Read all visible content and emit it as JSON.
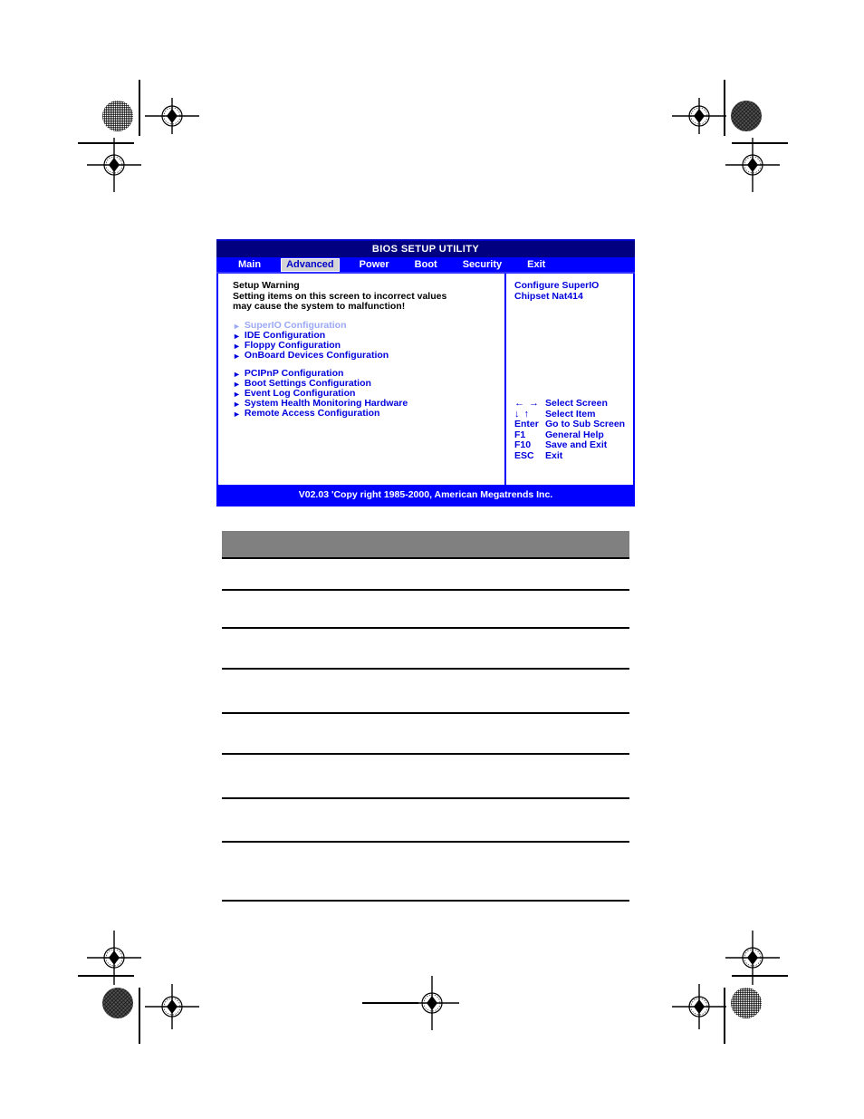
{
  "bios": {
    "title": "BIOS SETUP UTILITY",
    "menu_tabs": [
      {
        "label": "Main",
        "active": false
      },
      {
        "label": "Advanced",
        "active": true
      },
      {
        "label": "Power",
        "active": false
      },
      {
        "label": "Boot",
        "active": false
      },
      {
        "label": "Security",
        "active": false
      },
      {
        "label": "Exit",
        "active": false
      }
    ],
    "warning": {
      "heading": "Setup Warning",
      "line1": "Setting items on this screen to incorrect values",
      "line2": "may cause the system to malfunction!"
    },
    "submenu_group_1": [
      {
        "label": "SuperIO Configuration",
        "selected": true
      },
      {
        "label": "IDE Configuration",
        "selected": false
      },
      {
        "label": "Floppy Configuration",
        "selected": false
      },
      {
        "label": "OnBoard Devices Configuration",
        "selected": false
      }
    ],
    "submenu_group_2": [
      {
        "label": "PCIPnP Configuration",
        "selected": false
      },
      {
        "label": "Boot Settings Configuration",
        "selected": false
      },
      {
        "label": "Event Log Configuration",
        "selected": false
      },
      {
        "label": "System Health Monitoring Hardware",
        "selected": false
      },
      {
        "label": "Remote Access Configuration",
        "selected": false
      }
    ],
    "help": {
      "line1": "Configure SuperIO",
      "line2": "Chipset Nat414"
    },
    "key_legend": [
      {
        "keys": "←  →",
        "desc": "Select Screen",
        "arrows": true
      },
      {
        "keys": "↓  ↑",
        "desc": "Select Item",
        "arrows": true
      },
      {
        "keys": "Enter",
        "desc": "Go to Sub Screen",
        "arrows": false
      },
      {
        "keys": "F1",
        "desc": "General Help",
        "arrows": false
      },
      {
        "keys": "F10",
        "desc": "Save and Exit",
        "arrows": false
      },
      {
        "keys": "ESC",
        "desc": "Exit",
        "arrows": false
      }
    ],
    "footer": "V02.03 'Copy  right 1985-2000, American Megatrends Inc.",
    "colors": {
      "titlebar": "#000080",
      "menubar": "#0000ff",
      "accent_text": "#0000dd",
      "selected_tab_bg": "#d4d4d4",
      "dim_text": "#9aa8f5",
      "table_header": "#808080"
    }
  },
  "document": {
    "table_rule_tops": [
      650,
      692,
      737,
      786,
      831,
      880,
      928,
      993
    ]
  },
  "press_marks": {
    "registration_count": 8,
    "density_patch_count": 4
  }
}
